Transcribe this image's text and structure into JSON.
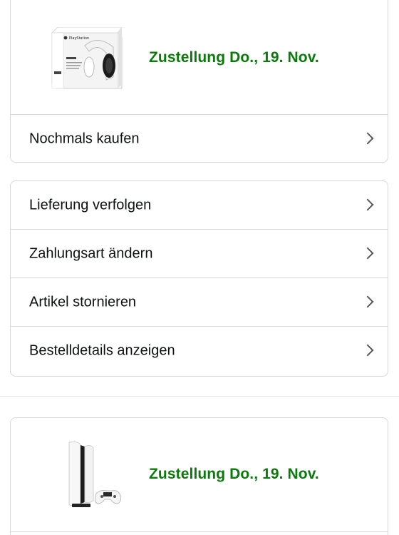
{
  "shipments": [
    {
      "delivery": "Zustellung Do., 19. Nov.",
      "product_image": "playstation-pulse-3d-headset-box",
      "action": "Nochmals kaufen"
    },
    {
      "delivery": "Zustellung Do., 19. Nov.",
      "product_image": "playstation-5-console-with-controller"
    }
  ],
  "actions": [
    {
      "label": "Lieferung verfolgen",
      "icon": "chevron-right-icon"
    },
    {
      "label": "Zahlungsart ändern",
      "icon": "chevron-right-icon"
    },
    {
      "label": "Artikel stornieren",
      "icon": "chevron-right-icon"
    },
    {
      "label": "Bestelldetails anzeigen",
      "icon": "chevron-right-icon"
    }
  ],
  "colors": {
    "delivery_green": "#0a7a0a",
    "border": "#d5d9d9",
    "chevron": "#565959"
  }
}
